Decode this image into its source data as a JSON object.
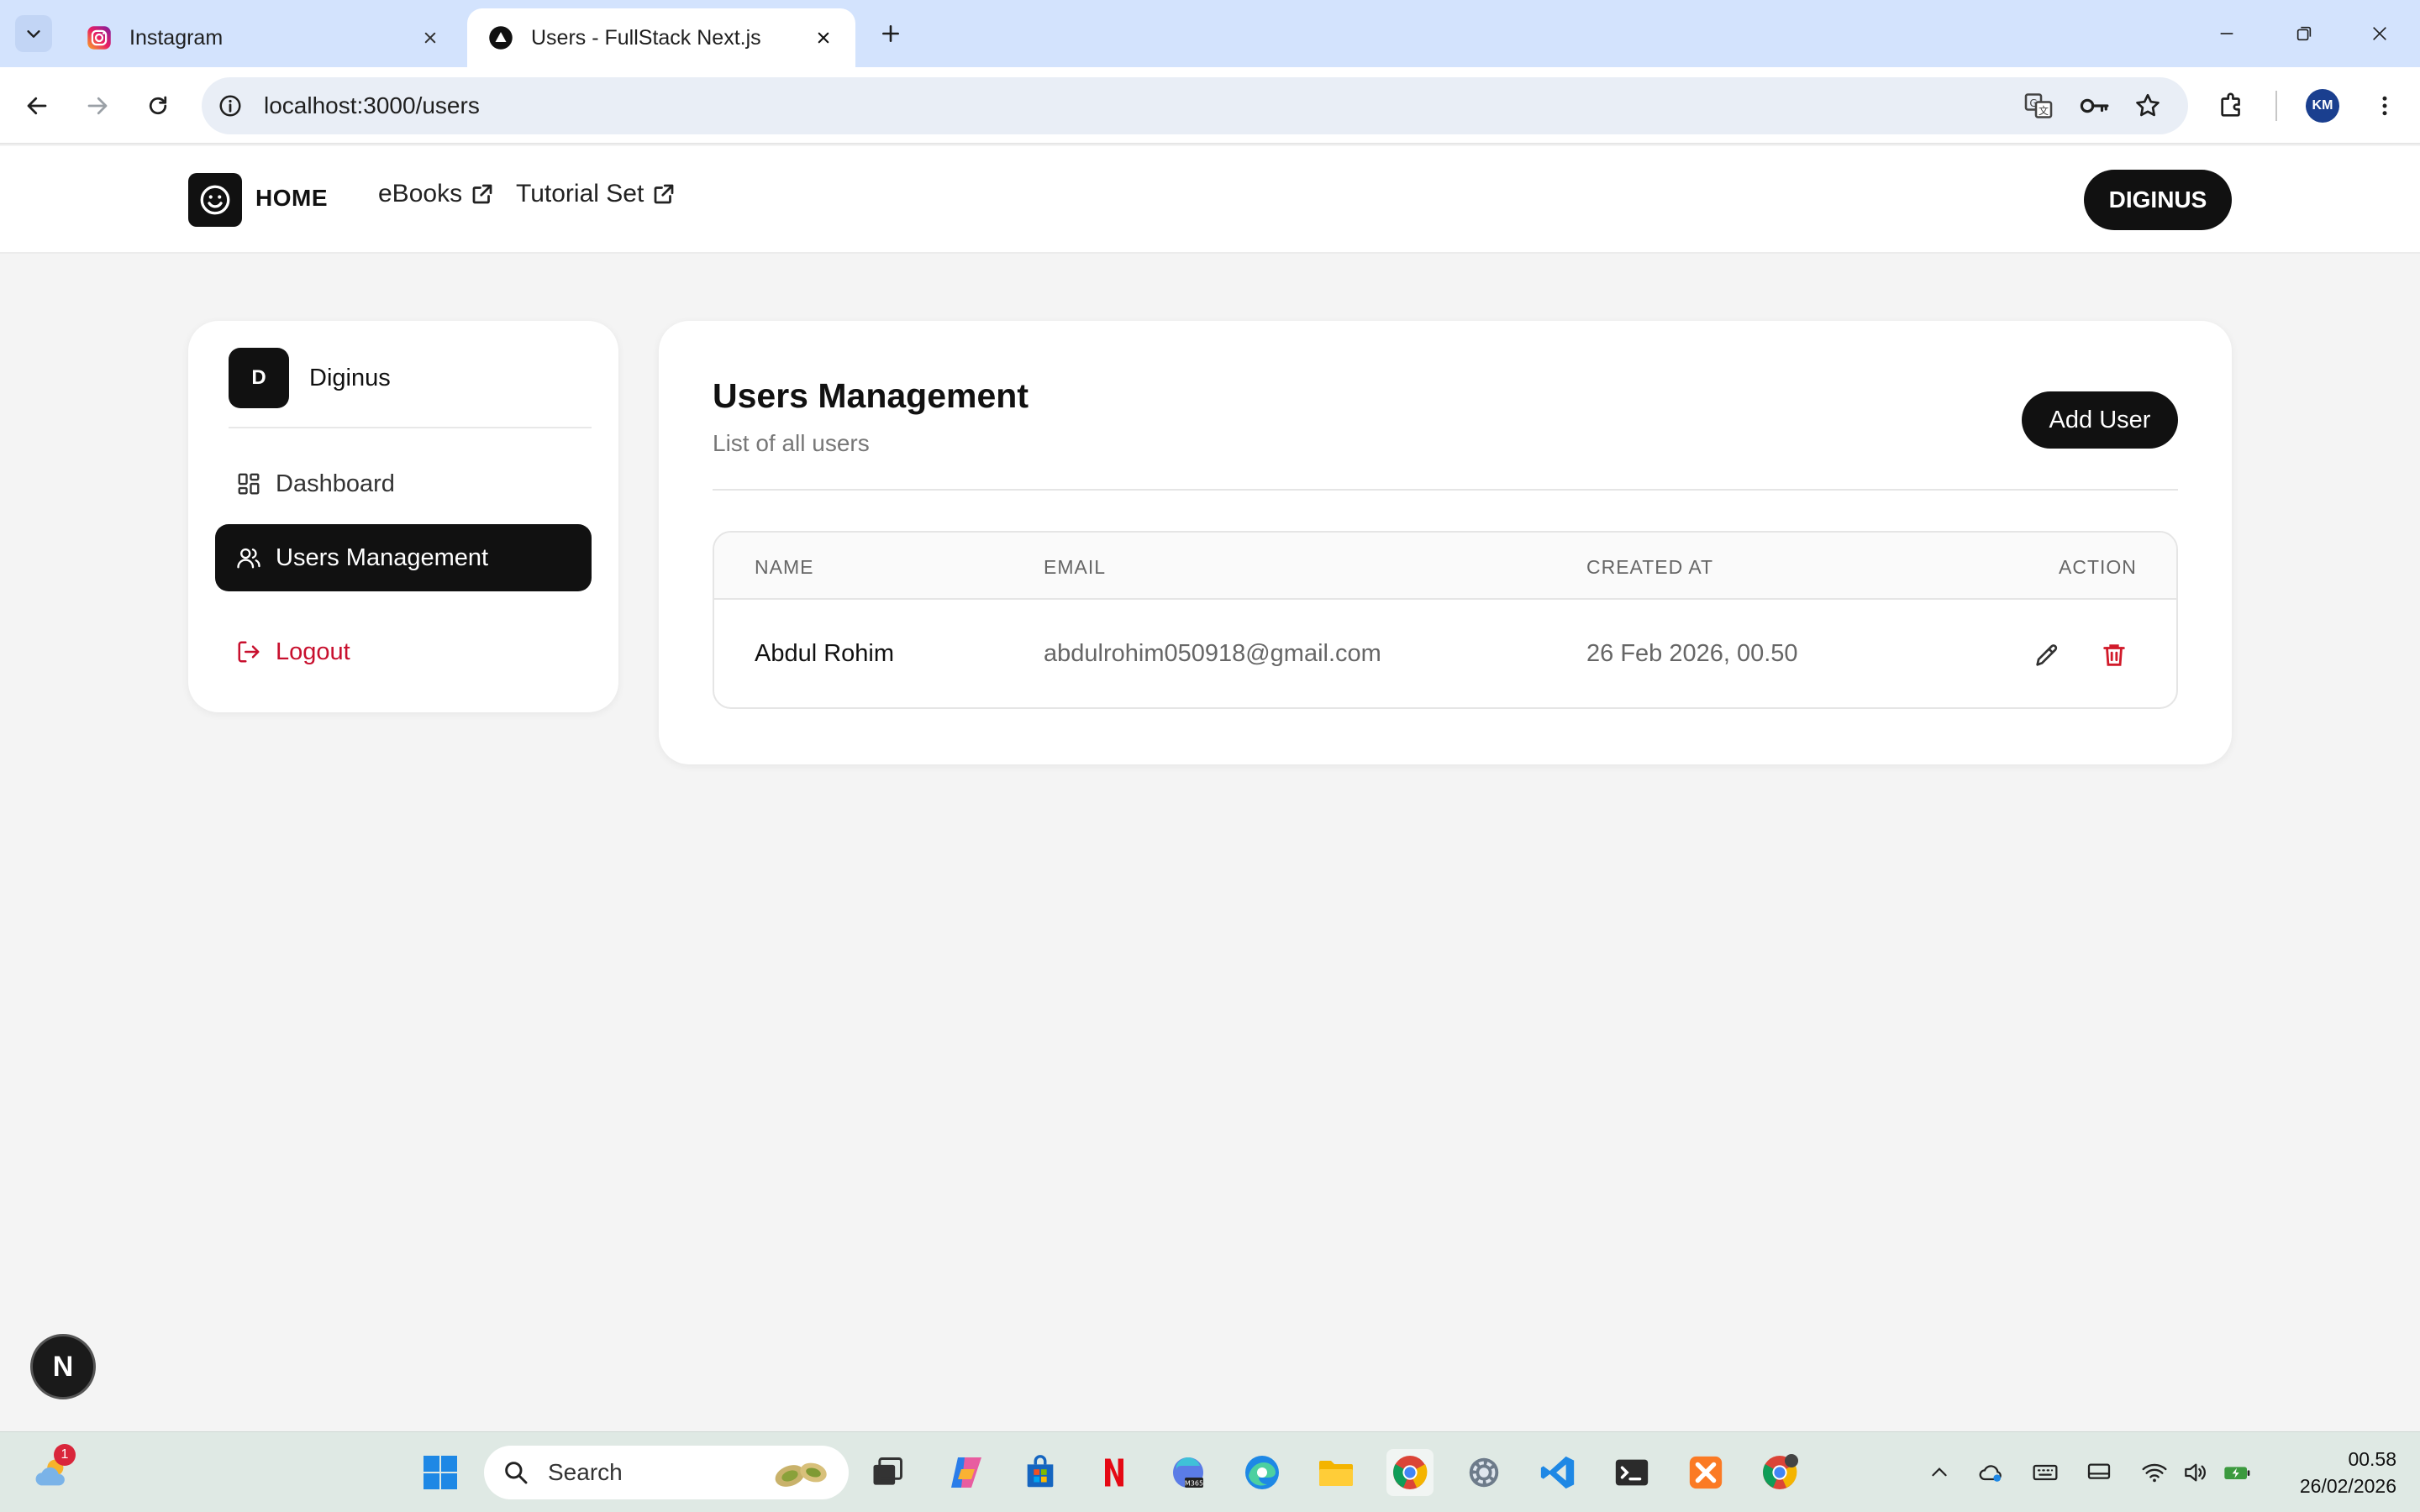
{
  "browser": {
    "tabs": [
      {
        "title": "Instagram",
        "icon": "instagram-icon",
        "active": false
      },
      {
        "title": "Users - FullStack Next.js",
        "icon": "nextjs-triangle-icon",
        "active": true
      }
    ],
    "url": "localhost:3000/users"
  },
  "header": {
    "home_label": "HOME",
    "links": [
      {
        "label": "eBooks",
        "icon": "external-link-icon"
      },
      {
        "label": "Tutorial Set",
        "icon": "external-link-icon"
      }
    ],
    "user_button": "DIGINUS"
  },
  "sidebar": {
    "avatar_initial": "D",
    "user_name": "Diginus",
    "items": [
      {
        "label": "Dashboard",
        "icon": "dashboard-grid-icon",
        "active": false
      },
      {
        "label": "Users Management",
        "icon": "users-icon",
        "active": true
      }
    ],
    "logout_label": "Logout"
  },
  "main": {
    "title": "Users Management",
    "subtitle": "List of all users",
    "add_button": "Add User",
    "table": {
      "columns": [
        "NAME",
        "EMAIL",
        "CREATED AT",
        "ACTION"
      ],
      "rows": [
        {
          "name": "Abdul Rohim",
          "email": "abdulrohim050918@gmail.com",
          "created_at": "26 Feb 2026, 00.50"
        }
      ]
    }
  },
  "dev_indicator": "N",
  "taskbar": {
    "search_placeholder": "Search",
    "weather_badge": "1",
    "time": "00.58",
    "date": "26/02/2026"
  },
  "colors": {
    "accent_dark": "#111111",
    "danger": "#c8102e",
    "tabbar_bg": "#d3e3fd",
    "page_bg": "#f4f4f4"
  }
}
